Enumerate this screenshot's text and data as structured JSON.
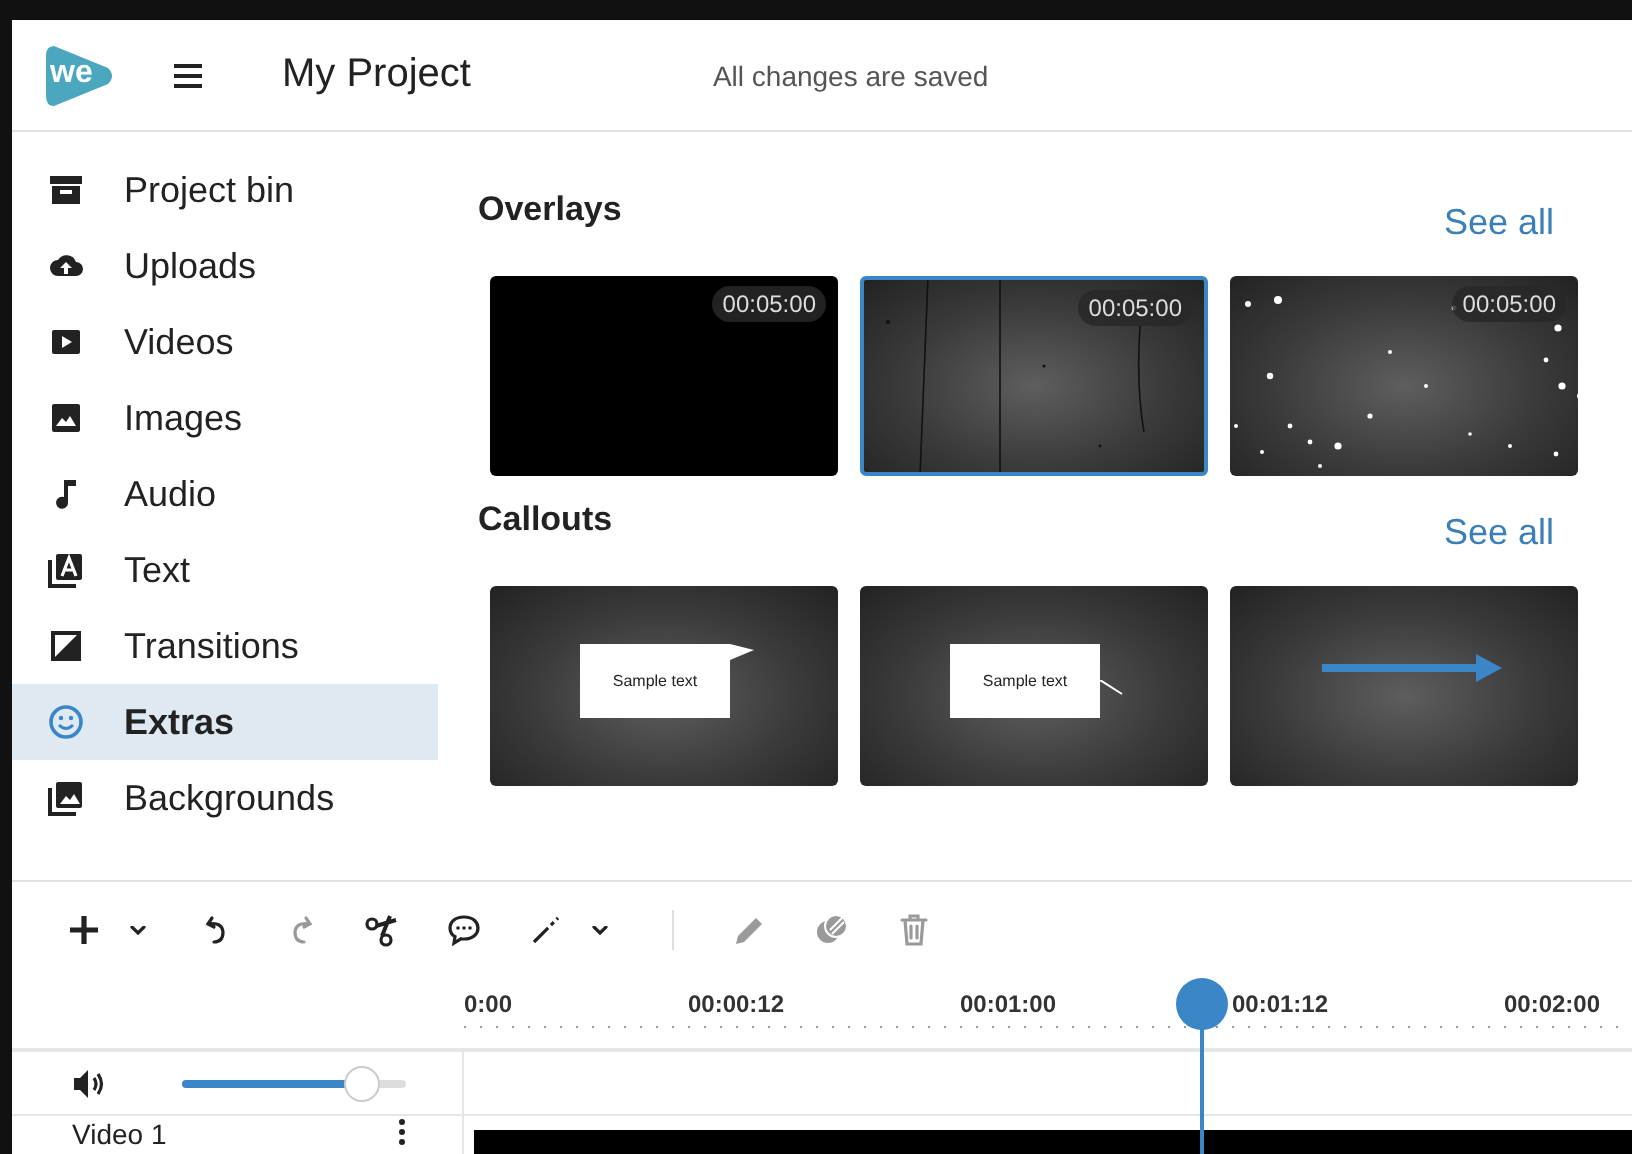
{
  "header": {
    "logo": "we",
    "title": "My Project",
    "status": "All changes are saved"
  },
  "sidebar": {
    "items": [
      {
        "label": "Project bin",
        "kind": "archive",
        "selected": false
      },
      {
        "label": "Uploads",
        "kind": "upload",
        "selected": false
      },
      {
        "label": "Videos",
        "kind": "video",
        "selected": false
      },
      {
        "label": "Images",
        "kind": "image",
        "selected": false
      },
      {
        "label": "Audio",
        "kind": "note",
        "selected": false
      },
      {
        "label": "Text",
        "kind": "text",
        "selected": false
      },
      {
        "label": "Transitions",
        "kind": "transition",
        "selected": false
      },
      {
        "label": "Extras",
        "kind": "smile",
        "selected": true
      },
      {
        "label": "Backgrounds",
        "kind": "backgrounds",
        "selected": false
      }
    ]
  },
  "sections": [
    {
      "title": "Overlays",
      "link": "See all",
      "items": [
        {
          "kind": "black",
          "duration": "00:05:00",
          "selected": false
        },
        {
          "kind": "scratches",
          "duration": "00:05:00",
          "selected": true
        },
        {
          "kind": "dust",
          "duration": "00:05:00",
          "selected": false
        }
      ]
    },
    {
      "title": "Callouts",
      "link": "See all",
      "items": [
        {
          "kind": "speech",
          "text": "Sample text",
          "selected": false
        },
        {
          "kind": "pointer",
          "text": "Sample text",
          "selected": false
        },
        {
          "kind": "arrow",
          "selected": false
        }
      ]
    }
  ],
  "toolbar": [
    {
      "kind": "add",
      "disabled": false
    },
    {
      "kind": "caret",
      "disabled": false
    },
    {
      "kind": "undo",
      "disabled": false
    },
    {
      "kind": "redo",
      "disabled": true
    },
    {
      "kind": "cut",
      "disabled": false
    },
    {
      "kind": "comment",
      "disabled": false
    },
    {
      "kind": "line",
      "disabled": false
    },
    {
      "kind": "caret",
      "disabled": false
    },
    {
      "kind": "separator"
    },
    {
      "kind": "pencil",
      "disabled": true
    },
    {
      "kind": "fill",
      "disabled": true
    },
    {
      "kind": "trash",
      "disabled": true
    }
  ],
  "timeline": {
    "ruler": [
      "0:00",
      "00:00:12",
      "00:01:00",
      "00:01:12",
      "00:02:00"
    ],
    "volume": {
      "level": 0.74
    },
    "tracks": [
      {
        "name": "Video 1"
      }
    ]
  }
}
